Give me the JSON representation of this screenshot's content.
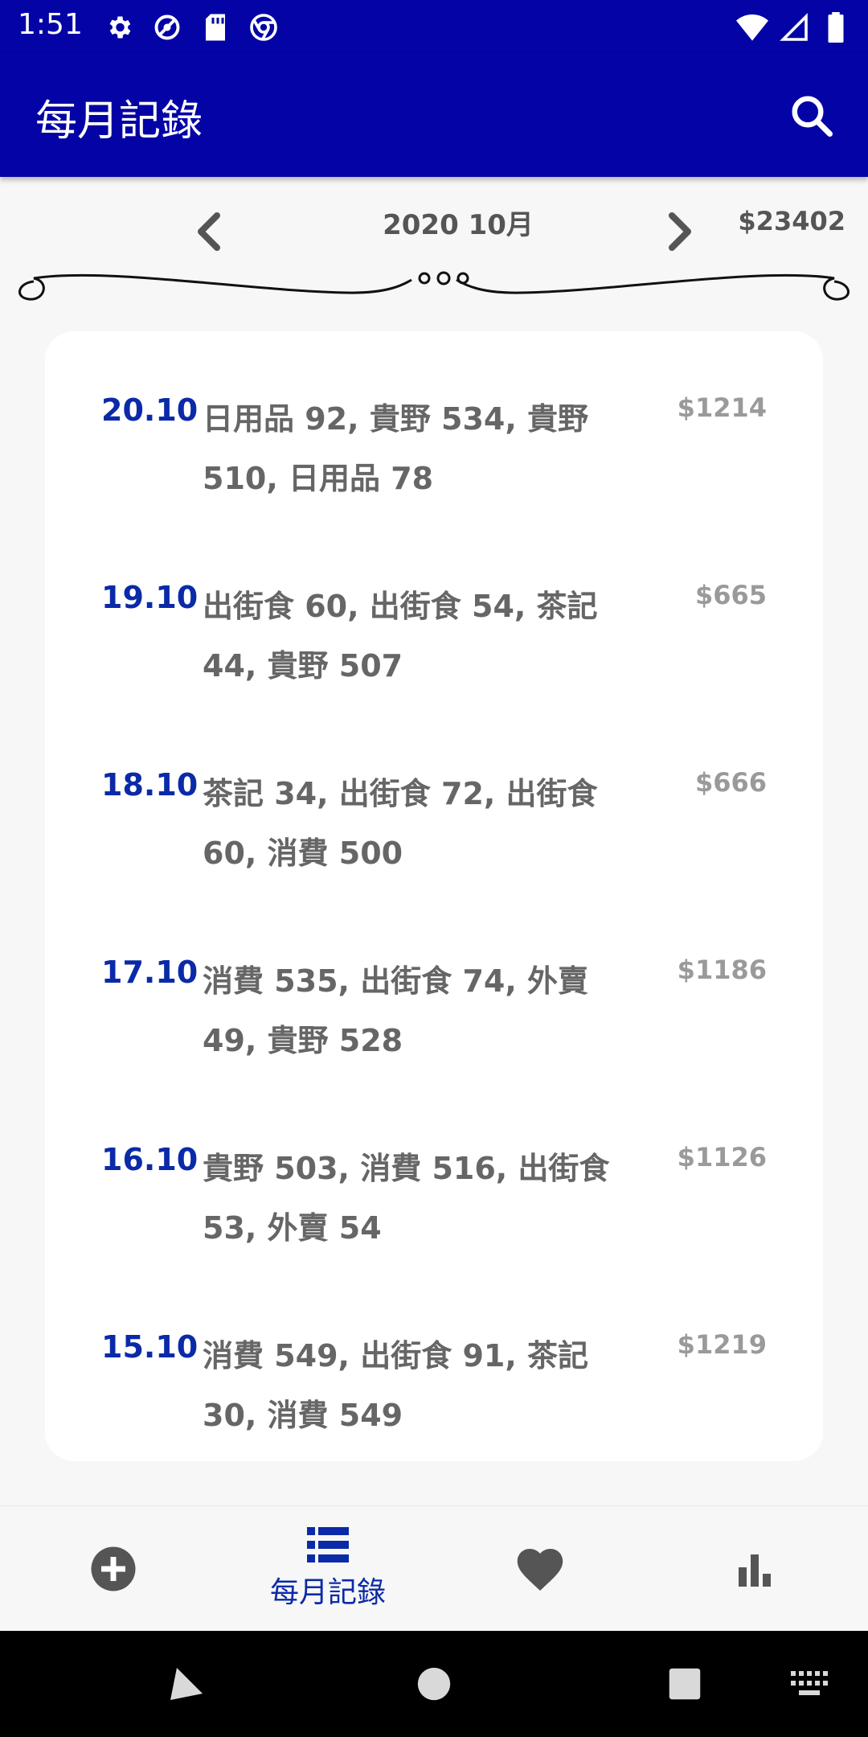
{
  "statusbar": {
    "time": "1:51",
    "icons_left": [
      "settings-icon",
      "no-location-icon",
      "sd-card-icon",
      "chrome-icon"
    ],
    "icons_right": [
      "wifi-icon",
      "signal-icon",
      "battery-icon"
    ]
  },
  "appbar": {
    "title": "每月記錄",
    "search_icon": "search-icon"
  },
  "month_header": {
    "label": "2020 10月",
    "total": "$23402"
  },
  "entries": [
    {
      "date": "20.10",
      "items": "日用品 92, 貴野 534, 貴野 510, 日用品 78",
      "amount": "$1214"
    },
    {
      "date": "19.10",
      "items": "出街食 60, 出街食 54, 茶記 44, 貴野 507",
      "amount": "$665"
    },
    {
      "date": "18.10",
      "items": "茶記 34, 出街食 72, 出街食 60, 消費 500",
      "amount": "$666"
    },
    {
      "date": "17.10",
      "items": "消費 535, 出街食 74, 外賣 49, 貴野 528",
      "amount": "$1186"
    },
    {
      "date": "16.10",
      "items": "貴野 503, 消費 516, 出街食 53, 外賣 54",
      "amount": "$1126"
    },
    {
      "date": "15.10",
      "items": "消費 549, 出街食 91, 茶記 30, 消費 549",
      "amount": "$1219"
    }
  ],
  "bottomnav": {
    "items": [
      {
        "icon": "add-circle-icon",
        "label": ""
      },
      {
        "icon": "list-icon",
        "label": "每月記錄"
      },
      {
        "icon": "heart-icon",
        "label": ""
      },
      {
        "icon": "bar-chart-icon",
        "label": ""
      }
    ],
    "active_color": "#0b2aa8"
  },
  "colors": {
    "primary": "#0303a6",
    "date_blue": "#0b2aa8",
    "text_gray": "#666666",
    "amount_gray": "#9a9a9a"
  }
}
